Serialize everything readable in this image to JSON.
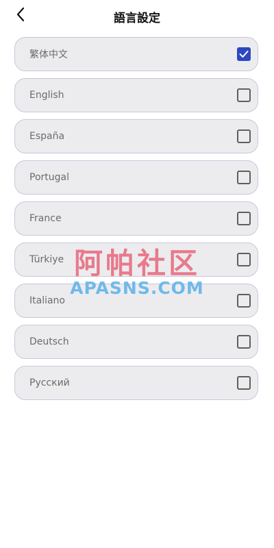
{
  "header": {
    "title": "語言設定",
    "back_icon": "chevron-left-icon"
  },
  "languages": [
    {
      "label": "繁体中文",
      "checked": true
    },
    {
      "label": "English",
      "checked": false
    },
    {
      "label": "España",
      "checked": false
    },
    {
      "label": "Portugal",
      "checked": false
    },
    {
      "label": "France",
      "checked": false
    },
    {
      "label": "Türkiye",
      "checked": false
    },
    {
      "label": "Italiano",
      "checked": false
    },
    {
      "label": "Deutsch",
      "checked": false
    },
    {
      "label": "Русский",
      "checked": false
    }
  ],
  "watermark": {
    "cn": "阿帕社区",
    "en": "APASNS.COM"
  },
  "colors": {
    "accent": "#2d47c1",
    "item_bg": "#ececef",
    "item_border": "#c9c6da",
    "watermark_cn": "#e8667a",
    "watermark_en": "#5cb0e7"
  }
}
